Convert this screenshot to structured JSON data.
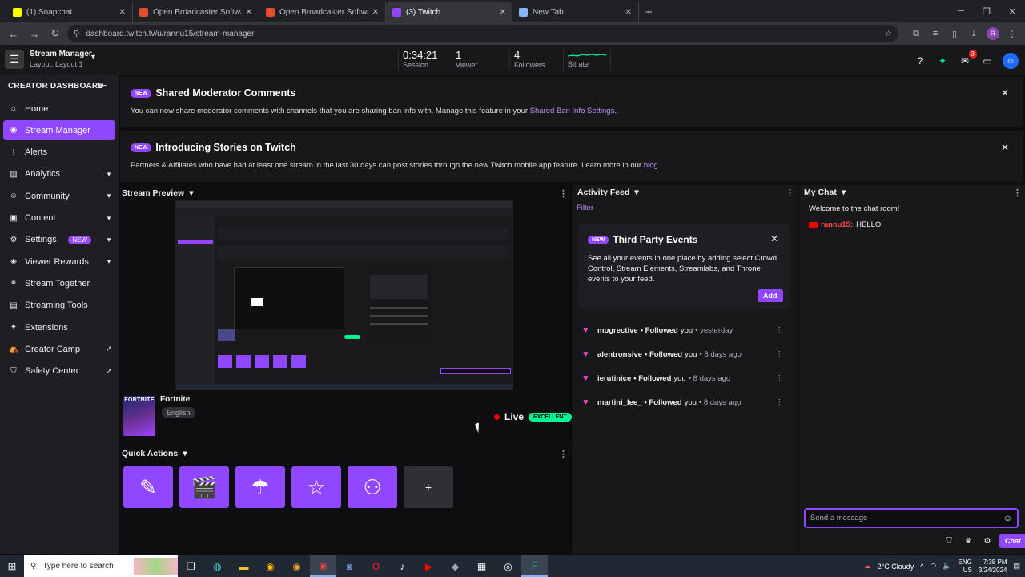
{
  "browser": {
    "tabs": [
      {
        "title": "(1) Snapchat",
        "favicon_color": "#fffc00",
        "active": false
      },
      {
        "title": "Open Broadcaster Software | O",
        "favicon_color": "#e54c2a",
        "active": false
      },
      {
        "title": "Open Broadcaster Software | O",
        "favicon_color": "#e54c2a",
        "active": false
      },
      {
        "title": "(3) Twitch",
        "favicon_color": "#9147ff",
        "active": true
      },
      {
        "title": "New Tab",
        "favicon_color": "#8ab4f8",
        "active": false
      }
    ],
    "url": "dashboard.twitch.tv/u/rannu15/stream-manager",
    "profile_initial": "R"
  },
  "topbar": {
    "title": "Stream Manager",
    "layout": "Layout: Layout 1",
    "stats": {
      "session_value": "0:34:21",
      "session_label": "Session",
      "viewer_value": "1",
      "viewer_label": "Viewer",
      "followers_value": "4",
      "followers_label": "Followers",
      "bitrate_label": "Bitrate"
    },
    "notification_count": "3"
  },
  "sidebar": {
    "heading": "CREATOR DASHBOARD",
    "items": [
      {
        "label": "Home",
        "icon": "home-icon",
        "glyph": "⌂",
        "chevron": false
      },
      {
        "label": "Stream Manager",
        "icon": "radio-icon",
        "glyph": "◉",
        "chevron": false,
        "active": true
      },
      {
        "label": "Alerts",
        "icon": "alert-icon",
        "glyph": "!",
        "chevron": false
      },
      {
        "label": "Analytics",
        "icon": "analytics-icon",
        "glyph": "▥",
        "chevron": true
      },
      {
        "label": "Community",
        "icon": "community-icon",
        "glyph": "☺",
        "chevron": true
      },
      {
        "label": "Content",
        "icon": "content-icon",
        "glyph": "▣",
        "chevron": true
      },
      {
        "label": "Settings",
        "icon": "gear-icon",
        "glyph": "⚙",
        "chevron": true,
        "badge": "NEW"
      },
      {
        "label": "Viewer Rewards",
        "icon": "rewards-icon",
        "glyph": "◈",
        "chevron": true
      },
      {
        "label": "Stream Together",
        "icon": "together-icon",
        "glyph": "⚭",
        "chevron": false
      },
      {
        "label": "Streaming Tools",
        "icon": "tools-icon",
        "glyph": "▤",
        "chevron": false
      },
      {
        "label": "Extensions",
        "icon": "extensions-icon",
        "glyph": "✦",
        "chevron": false
      },
      {
        "label": "Creator Camp",
        "icon": "camp-icon",
        "glyph": "⛺",
        "external": true
      },
      {
        "label": "Safety Center",
        "icon": "shield-icon",
        "glyph": "⛉",
        "external": true
      }
    ]
  },
  "banners": [
    {
      "tag": "NEW",
      "title": "Shared Moderator Comments",
      "desc": "You can now share moderator comments with channels that you are sharing ban info with. Manage this feature in your ",
      "link": "Shared Ban Info Settings",
      "after": "."
    },
    {
      "tag": "NEW",
      "title": "Introducing Stories on Twitch",
      "desc": "Partners & Affiliates who have had at least one stream in the last 30 days can post stories through the new Twitch mobile app feature. Learn more in our ",
      "link": "blog",
      "after": "."
    }
  ],
  "preview": {
    "header": "Stream Preview",
    "game": "Fortnite",
    "art_label": "FORTNITE",
    "language": "English",
    "live_label": "Live",
    "quality": "EXCELLENT"
  },
  "quick_actions": {
    "header": "Quick Actions",
    "buttons": [
      {
        "icon": "pencil-icon",
        "glyph": "✎"
      },
      {
        "icon": "clapper-icon",
        "glyph": "🎬"
      },
      {
        "icon": "raid-icon",
        "glyph": "☂"
      },
      {
        "icon": "star-icon",
        "glyph": "☆"
      },
      {
        "icon": "add-user-icon",
        "glyph": "⚇"
      },
      {
        "icon": "plus-icon",
        "glyph": "+"
      }
    ]
  },
  "activity_feed": {
    "header": "Activity Feed",
    "filter": "Filter",
    "card": {
      "tag": "NEW",
      "title": "Third Party Events",
      "desc": "See all your events in one place by adding select Crowd Control, Stream Elements, Streamlabs, and Throne events to your feed.",
      "add": "Add"
    },
    "events": [
      {
        "user": "mogrective",
        "action": "Followed",
        "you": "you",
        "when": "• yesterday"
      },
      {
        "user": "alentronsive",
        "action": "Followed",
        "you": "you",
        "when": "• 8 days ago"
      },
      {
        "user": "ierutinice",
        "action": "Followed",
        "you": "you",
        "when": "• 8 days ago"
      },
      {
        "user": "martini_lee_",
        "action": "Followed",
        "you": "you",
        "when": "• 8 days ago"
      }
    ]
  },
  "chat": {
    "header": "My Chat",
    "welcome": "Welcome to the chat room!",
    "messages": [
      {
        "user": "rannu15:",
        "text": "HELLO"
      }
    ],
    "placeholder": "Send a message",
    "send": "Chat"
  },
  "taskbar": {
    "search_placeholder": "Type here to search",
    "weather": "2°C  Cloudy",
    "lang": "ENG",
    "region": "US",
    "time": "7:38 PM",
    "date": "3/24/2024"
  },
  "colors": {
    "accent": "#9147ff",
    "live": "#eb0400",
    "excellent": "#00f593",
    "heart": "#ff4ad6"
  }
}
